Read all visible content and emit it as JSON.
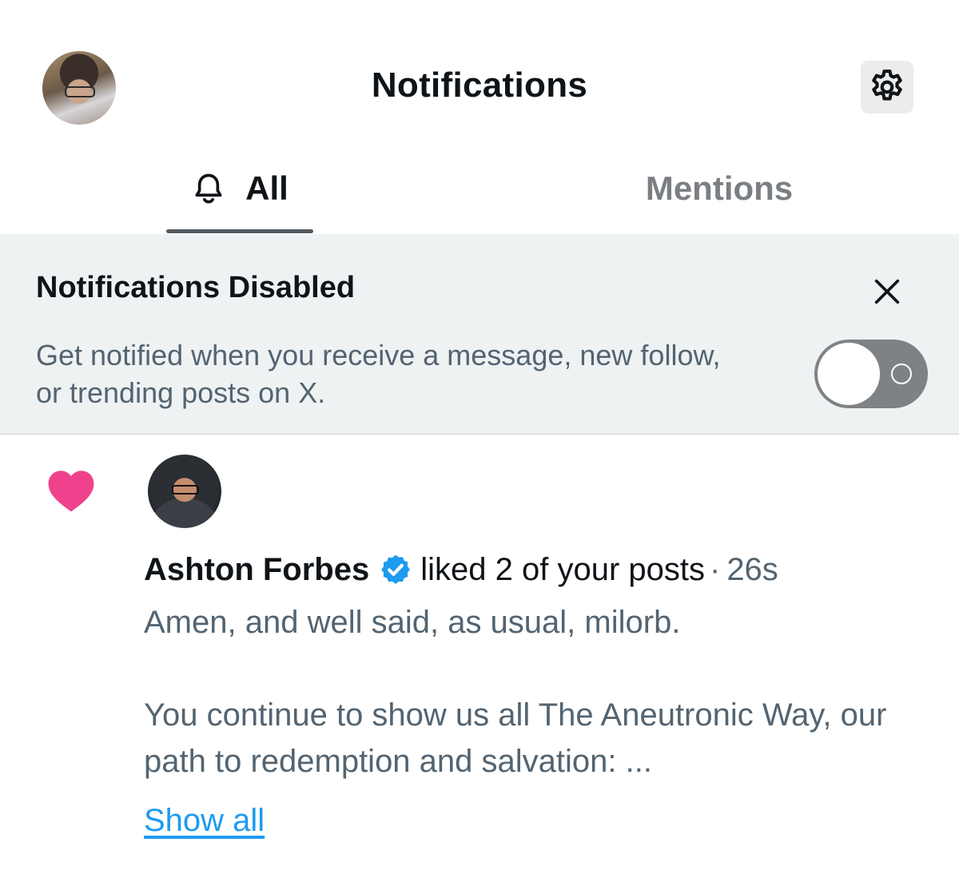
{
  "header": {
    "title": "Notifications",
    "avatar": "profile-avatar",
    "settings_icon": "gear-icon"
  },
  "tabs": [
    {
      "label": "All",
      "icon": "bell-icon",
      "active": true
    },
    {
      "label": "Mentions",
      "active": false
    }
  ],
  "banner": {
    "title": "Notifications Disabled",
    "text": "Get notified when you receive a message, new follow, or trending posts on X.",
    "close_icon": "close-icon",
    "toggle_on": false
  },
  "notification": {
    "icon": "heart-icon",
    "user_name": "Ashton Forbes",
    "verified": true,
    "action": "liked 2 of your posts",
    "separator": "·",
    "time": "26s",
    "post_text": "Amen, and well said, as usual, milorb.\n\nYou continue to show us all The Aneutronic Way, our path to redemption and salvation: ...",
    "show_all_label": "Show all"
  },
  "colors": {
    "heart": "#f0428c",
    "verified": "#1d9bf0",
    "banner_bg": "#eff2f3",
    "link": "#1d9bf0"
  }
}
